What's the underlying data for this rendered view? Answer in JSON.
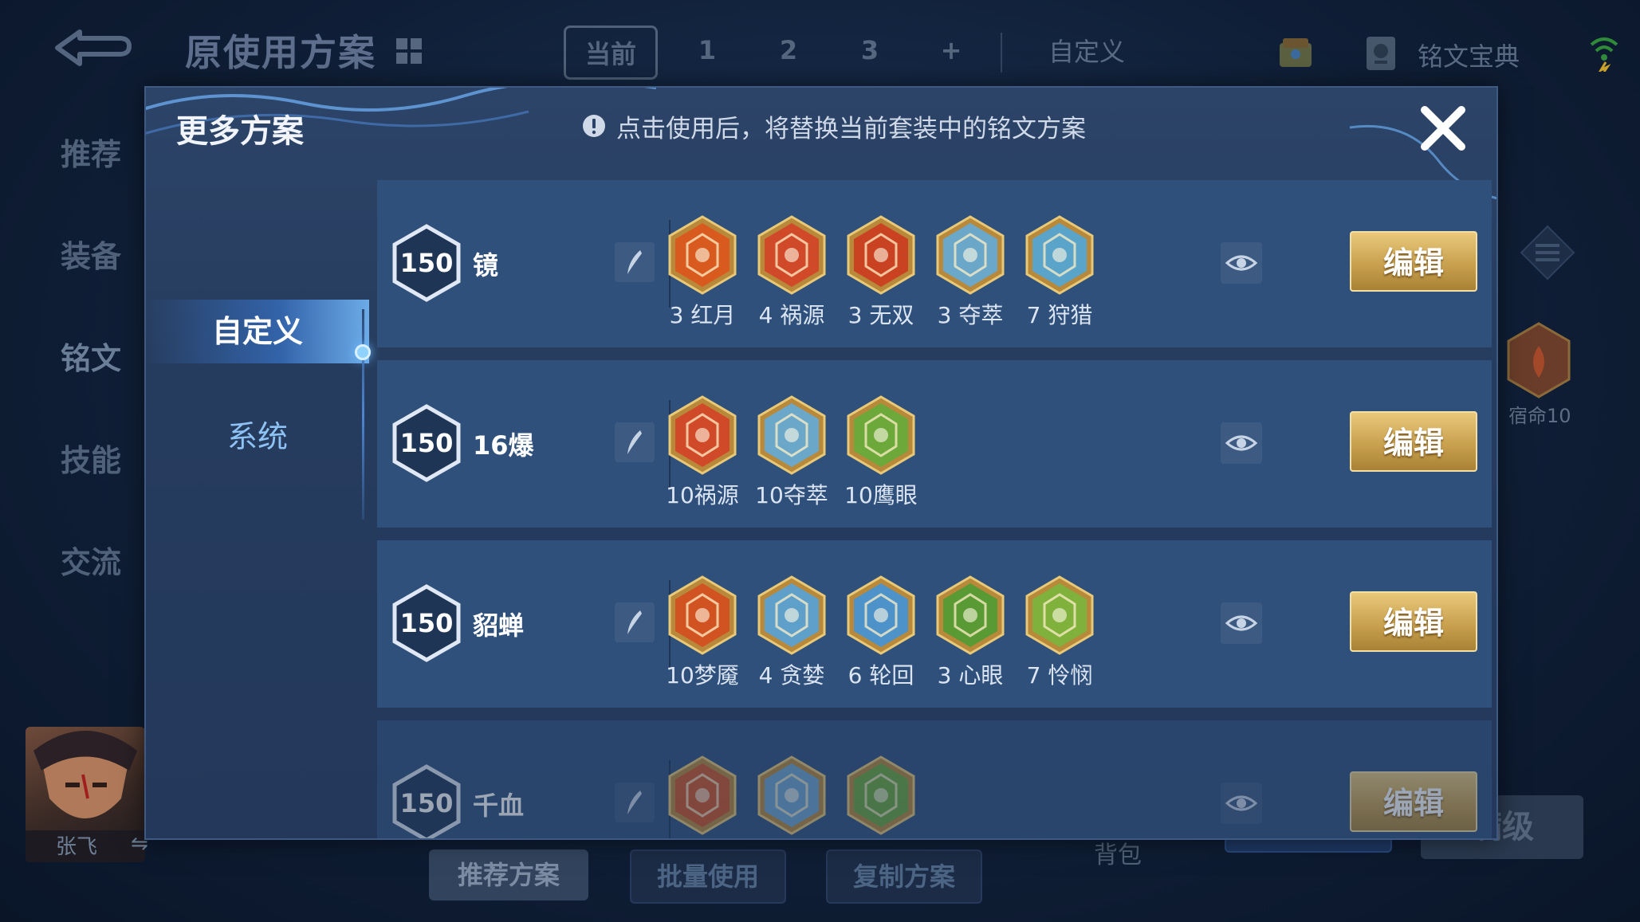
{
  "background": {
    "title": "原使用方案",
    "tabs": [
      "当前",
      "1",
      "2",
      "3",
      "+"
    ],
    "custom_tab": "自定义",
    "treasure_label": "铭文宝典",
    "nav": [
      "推荐",
      "装备",
      "铭文",
      "技能",
      "交流"
    ],
    "hero_name": "张飞",
    "swap_glyph": "⇋",
    "fate_label": "宿命10",
    "bottom_buttons": [
      "推荐方案",
      "批量使用",
      "复制方案"
    ],
    "bag_label": "背包",
    "max_level_button": "满级"
  },
  "modal": {
    "title": "更多方案",
    "hint": "点击使用后，将替换当前套装中的铭文方案",
    "side_tabs": [
      "自定义",
      "系统"
    ],
    "edit_label": "编辑",
    "plans": [
      {
        "level": "150",
        "name": "镜",
        "runes": [
          {
            "label": "3 红月",
            "icon": "red-moon-icon",
            "color": "#d85a1f"
          },
          {
            "label": "4 祸源",
            "icon": "calamity-icon",
            "color": "#d04a2a"
          },
          {
            "label": "3 无双",
            "icon": "peerless-icon",
            "color": "#c94322"
          },
          {
            "label": "3 夺萃",
            "icon": "plunder-icon",
            "color": "#6aa7c8"
          },
          {
            "label": "7 狩猎",
            "icon": "hunt-icon",
            "color": "#5aa4c9"
          }
        ]
      },
      {
        "level": "150",
        "name": "16爆",
        "runes": [
          {
            "label": "10祸源",
            "icon": "calamity-icon",
            "color": "#d04a2a"
          },
          {
            "label": "10夺萃",
            "icon": "plunder-icon",
            "color": "#6aa7c8"
          },
          {
            "label": "10鹰眼",
            "icon": "eagle-eye-icon",
            "color": "#6ca83a"
          }
        ]
      },
      {
        "level": "150",
        "name": "貂蝉",
        "runes": [
          {
            "label": "10梦魇",
            "icon": "nightmare-icon",
            "color": "#d25322"
          },
          {
            "label": "4 贪婪",
            "icon": "greed-icon",
            "color": "#5fa0cb"
          },
          {
            "label": "6 轮回",
            "icon": "samsara-icon",
            "color": "#4d92c8"
          },
          {
            "label": "3 心眼",
            "icon": "mind-eye-icon",
            "color": "#5a9a34"
          },
          {
            "label": "7 怜悯",
            "icon": "mercy-icon",
            "color": "#7fb13c"
          }
        ]
      },
      {
        "level": "150",
        "name": "千血",
        "runes": [
          {
            "label": "",
            "icon": "flame-icon",
            "color": "#cf5526"
          },
          {
            "label": "",
            "icon": "crystal-icon",
            "color": "#6fa6cf"
          },
          {
            "label": "",
            "icon": "leaf-icon",
            "color": "#6aa83a"
          }
        ]
      }
    ]
  }
}
